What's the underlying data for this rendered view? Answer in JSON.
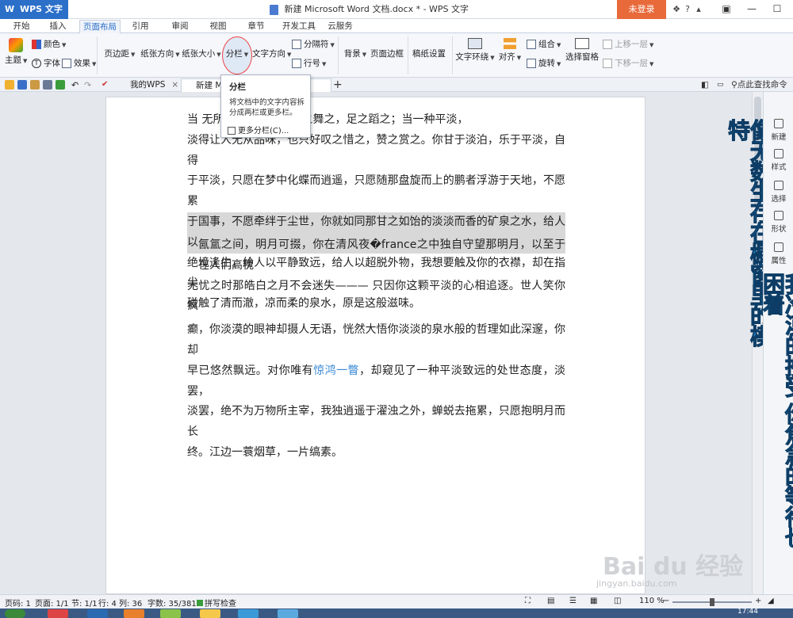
{
  "app": {
    "name": "WPS 文字",
    "logo": "W"
  },
  "window": {
    "title": "新建 Microsoft Word 文档.docx * - WPS 文字",
    "login_label": "未登录"
  },
  "tabs": [
    "开始",
    "插入",
    "页面布局",
    "引用",
    "审阅",
    "视图",
    "章节",
    "开发工具",
    "云服务"
  ],
  "active_tab": "页面布局",
  "ribbon": {
    "theme": "主题",
    "color": "颜色",
    "font": "字体",
    "effect": "效果",
    "margin": "页边距",
    "orientation": "纸张方向",
    "size": "纸张大小",
    "columns": "分栏",
    "text_direction": "文字方向",
    "separator": "分隔符",
    "line_number": "行号",
    "background": "背景",
    "page_border": "页面边框",
    "draft": "稿纸设置",
    "wrap": "文字环绕",
    "align": "对齐",
    "group": "组合",
    "rotate": "旋转",
    "selection_pane": "选择窗格",
    "bring_forward": "上移一层",
    "send_backward": "下移一层"
  },
  "doc_tabs": [
    {
      "label": "我的WPS"
    },
    {
      "label": "新建 Mi"
    }
  ],
  "search": {
    "label": "点此查找命令"
  },
  "popup": {
    "title": "分栏",
    "description": "将文档中的文字内容拆分成两栏或更多栏。",
    "more": "更多分栏(C)..."
  },
  "document": {
    "para1_line1": "当                        无所适从，也只好手之舞之，足之蹈之；当一种平淡，",
    "para1_line2": "淡得让人无从品味，也只好叹之惜之，赞之赏之。你甘于淡泊，乐于平淡，自得",
    "para1_line3": "于平淡，只愿在梦中化蝶而逍遥，只愿随那盘旋而上的鹏者浮游于天地，不愿累",
    "para1_line4": "于国事，不愿牵绊于尘世，你就如同那甘之如饴的淡淡而香的矿泉之水，给人以",
    "para1_line5": "绝境逢生，给人以平静致远，给人以超脱外物，我想要触及你的衣襟，却在指尖",
    "para1_line6": "碰触了清而澈，凉而柔的泉水，原是这般滋味。",
    "para2_line1": "氤氲之间，明月可掇，你在清风夜�france之中独自守望那明月，以至于在人们高枕",
    "para2_line2": "无忧之时那皓白之月不会迷失———  只因你这颗平淡的心相追逐。世人笑你疯",
    "para2_line3": "癫，你淡漠的眼神却摄人无语，恍然大悟你淡淡的泉水般的哲理如此深邃，你却",
    "para2_line4a": "早已悠然飘远。对你唯有",
    "para2_link": "惊鸿一瞥",
    "para2_line4b": "，却窥见了一种平淡致远的处世态度，淡罢，",
    "para2_line5": "淡罢，绝不为万物所主宰，我独逍遥于濯浊之外，蝉蜕去拖累，只愿抱明月而长",
    "para2_line6": "终。江边一蓑烟草，一片缟素。"
  },
  "overlay": {
    "col1": "像无数生存在橱窗里的模特",
    "col2": "我冷漠的接受  你焦急的等待也困着"
  },
  "right_panel": [
    "新建",
    "样式",
    "选择",
    "形状",
    "属性"
  ],
  "status": {
    "page_code": "页码: 1",
    "pages": "页面: 1/1",
    "section": "节: 1/1",
    "row": "行: 4",
    "col": "列: 36",
    "word_count": "字数: 35/381",
    "spell": "拼写检查",
    "zoom": "110 %"
  },
  "watermark": {
    "main": "Bai du 经验",
    "url": "jingyan.baidu.com"
  },
  "clock": "17:44",
  "colors": {
    "accent": "#2b6fc9",
    "login": "#e8693a",
    "overlay_text": "#1c8fd6",
    "highlight": "#d8d8d8"
  }
}
